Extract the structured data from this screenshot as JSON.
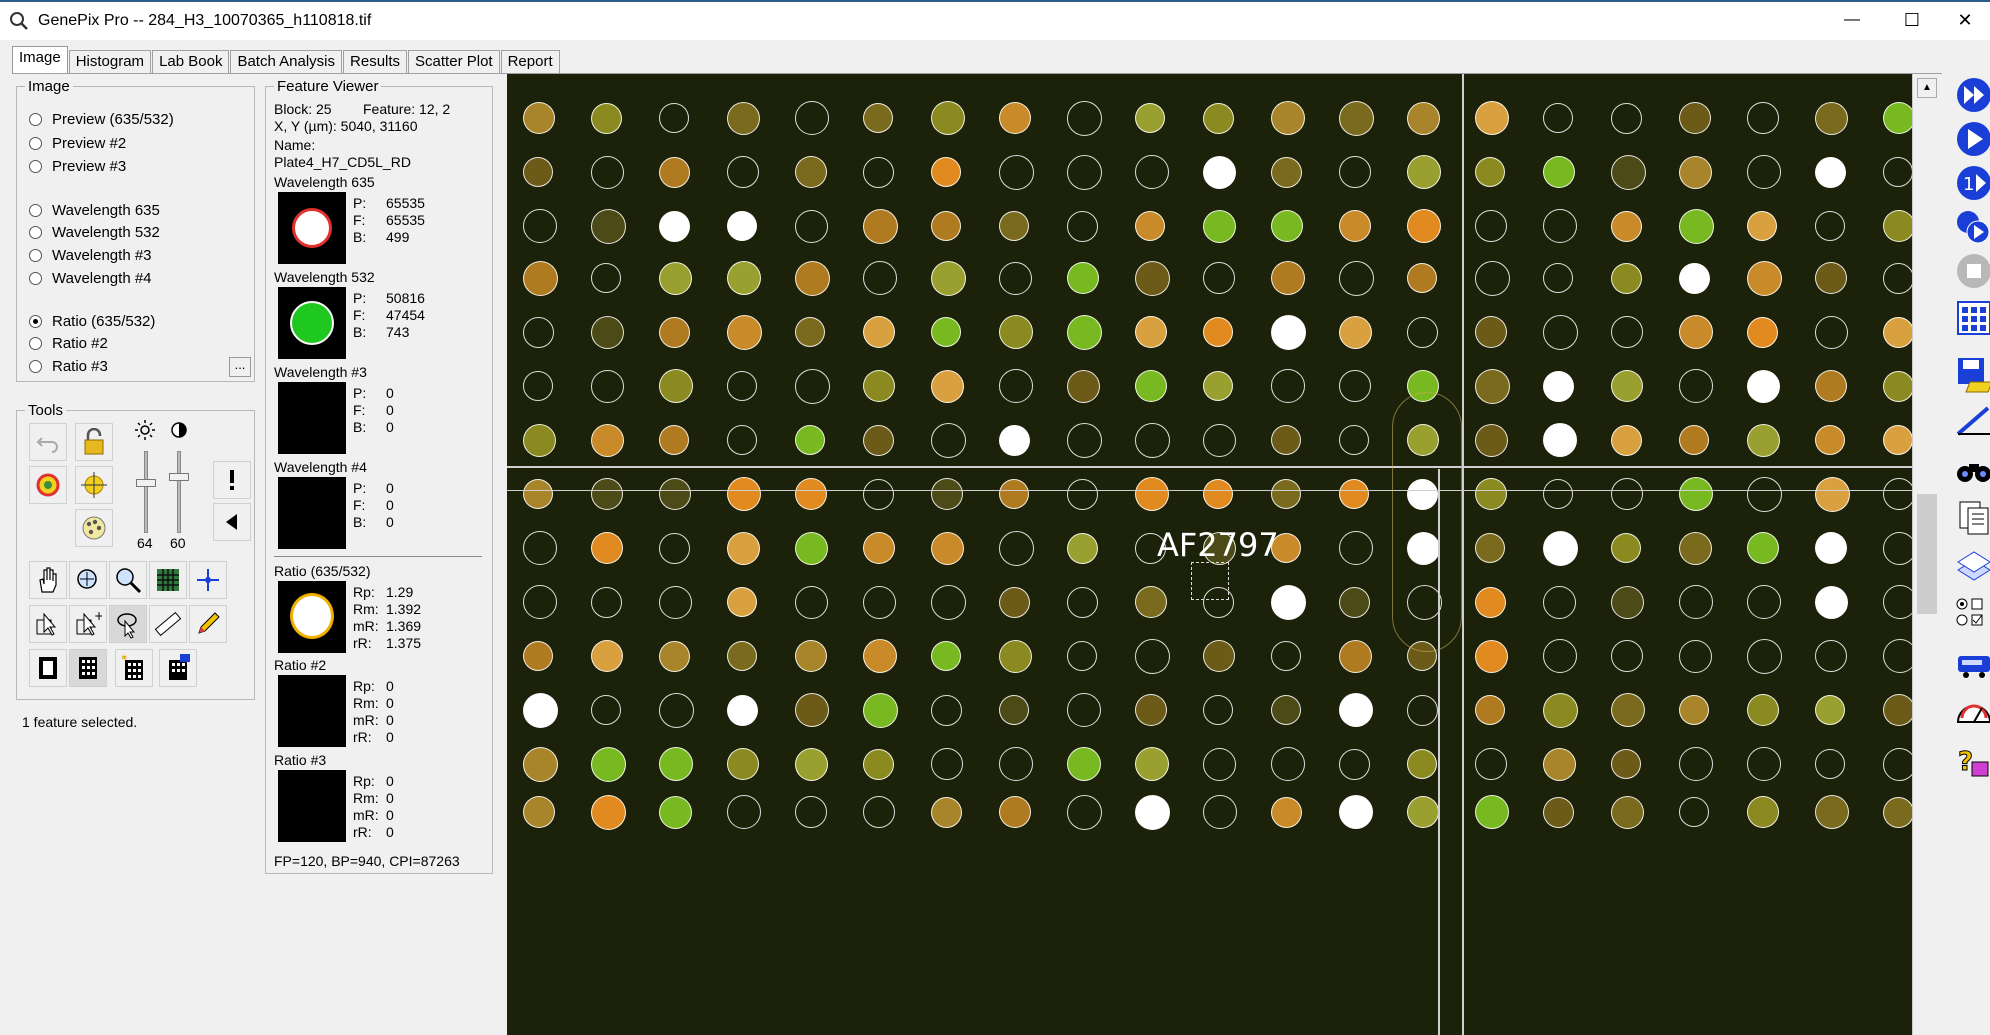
{
  "window": {
    "title": "GenePix Pro -- 284_H3_10070365_h110818.tif",
    "minimize": "—",
    "maximize": "☐",
    "close": "✕"
  },
  "tabs": [
    "Image",
    "Histogram",
    "Lab Book",
    "Batch Analysis",
    "Results",
    "Scatter Plot",
    "Report"
  ],
  "image_group": {
    "title": "Image",
    "options": [
      {
        "label": "Preview (635/532)",
        "selected": false
      },
      {
        "label": "Preview #2",
        "selected": false
      },
      {
        "label": "Preview #3",
        "selected": false
      },
      {
        "label": "Wavelength 635",
        "selected": false
      },
      {
        "label": "Wavelength 532",
        "selected": false
      },
      {
        "label": "Wavelength #3",
        "selected": false
      },
      {
        "label": "Wavelength #4",
        "selected": false
      },
      {
        "label": "Ratio (635/532)",
        "selected": true
      },
      {
        "label": "Ratio #2",
        "selected": false
      },
      {
        "label": "Ratio #3",
        "selected": false
      }
    ],
    "more_button": "..."
  },
  "tools": {
    "title": "Tools",
    "brightness_value": "64",
    "contrast_value": "60"
  },
  "status": "1 feature selected.",
  "feature_viewer": {
    "title": "Feature Viewer",
    "block": "Block: 25",
    "feature": "Feature:  12, 2",
    "xy": "X, Y (µm): 5040, 31160",
    "name_label": "Name:",
    "name": "Plate4_H7_CD5L_RD",
    "channels": [
      {
        "title": "Wavelength 635",
        "rows": [
          [
            "P:",
            "65535"
          ],
          [
            "F:",
            "65535"
          ],
          [
            "B:",
            "499"
          ]
        ]
      },
      {
        "title": "Wavelength 532",
        "rows": [
          [
            "P:",
            "50816"
          ],
          [
            "F:",
            "47454"
          ],
          [
            "B:",
            "743"
          ]
        ]
      },
      {
        "title": "Wavelength #3",
        "rows": [
          [
            "P:",
            "0"
          ],
          [
            "F:",
            "0"
          ],
          [
            "B:",
            "0"
          ]
        ]
      },
      {
        "title": "Wavelength #4",
        "rows": [
          [
            "P:",
            "0"
          ],
          [
            "F:",
            "0"
          ],
          [
            "B:",
            "0"
          ]
        ]
      }
    ],
    "ratios": [
      {
        "title": "Ratio (635/532)",
        "rows": [
          [
            "Rp:",
            "1.29"
          ],
          [
            "Rm:",
            "1.392"
          ],
          [
            "mR:",
            "1.369"
          ],
          [
            "rR:",
            "1.375"
          ]
        ]
      },
      {
        "title": "Ratio #2",
        "rows": [
          [
            "Rp:",
            "0"
          ],
          [
            "Rm:",
            "0"
          ],
          [
            "mR:",
            "0"
          ],
          [
            "rR:",
            "0"
          ]
        ]
      },
      {
        "title": "Ratio #3",
        "rows": [
          [
            "Rp:",
            "0"
          ],
          [
            "Rm:",
            "0"
          ],
          [
            "mR:",
            "0"
          ],
          [
            "rR:",
            "0"
          ]
        ]
      }
    ],
    "footer": "FP=120, BP=940, CPI=87263"
  },
  "image_view": {
    "selected_label": "AF2797"
  },
  "colors": {
    "image_background": "#1b2209",
    "tab_border": "#a0a0a0",
    "toolbar_blue": "#1a3fd6"
  }
}
